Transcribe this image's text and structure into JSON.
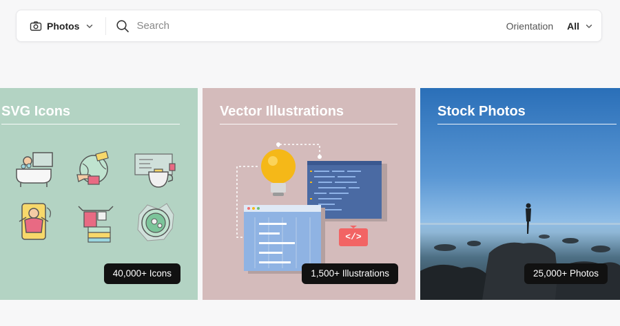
{
  "search": {
    "type_label": "Photos",
    "placeholder": "Search",
    "orientation_label": "Orientation",
    "orientation_value": "All"
  },
  "cards": [
    {
      "title": "SVG Icons",
      "count": "40,000+ Icons"
    },
    {
      "title": "Vector Illustrations",
      "count": "1,500+ Illustrations",
      "code_tag": "</>"
    },
    {
      "title": "Stock Photos",
      "count": "25,000+ Photos"
    }
  ],
  "colors": {
    "svg_card_bg": "#b3d3c3",
    "vector_card_bg": "#d4bbbb",
    "photo_sky": "#2a6fb8",
    "badge_bg": "#111111"
  }
}
